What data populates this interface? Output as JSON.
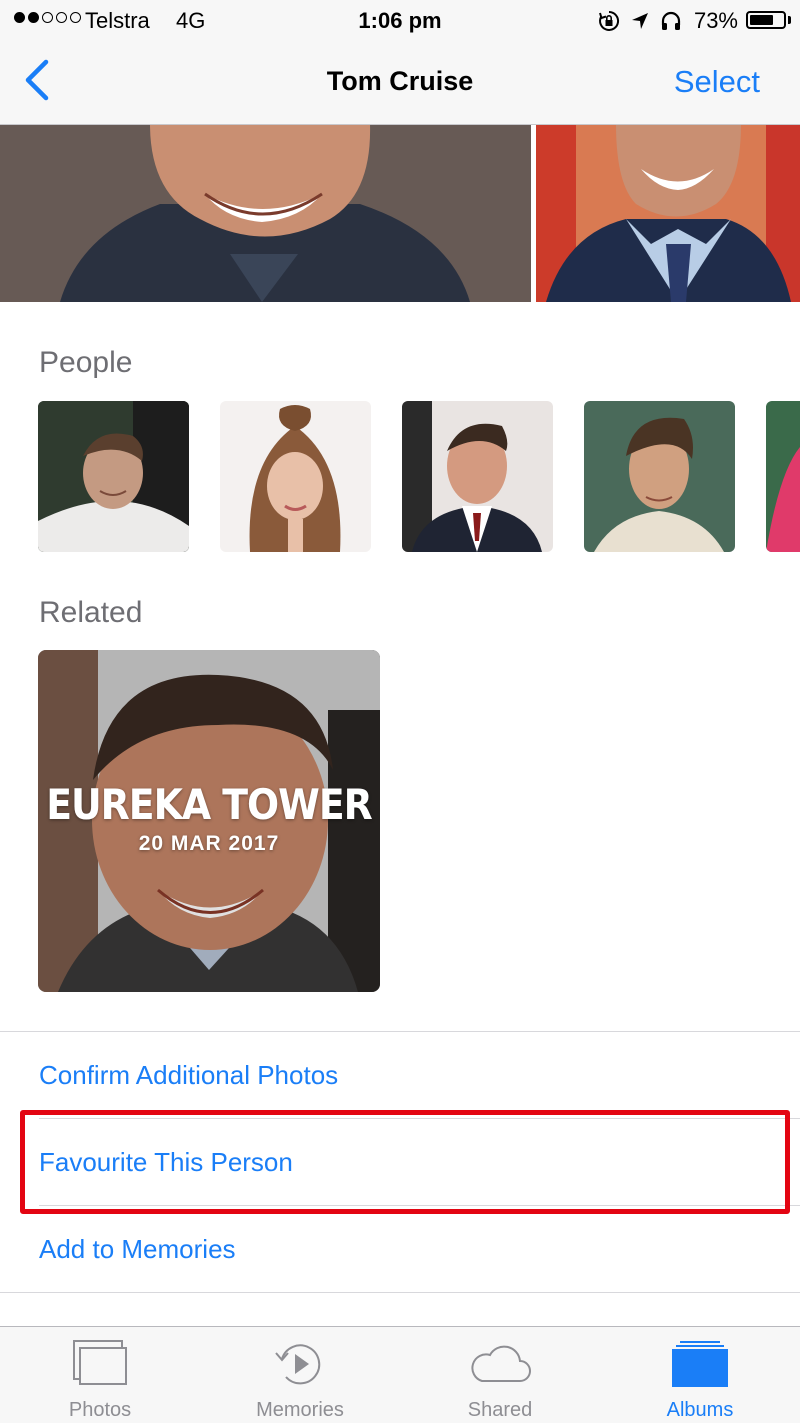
{
  "status_bar": {
    "signal_bars_filled": 2,
    "signal_bars_total": 5,
    "carrier": "Telstra",
    "network": "4G",
    "time": "1:06 pm",
    "battery_percent": "73%",
    "battery_level": 0.73,
    "icons": [
      "orientation-lock-icon",
      "location-arrow-icon",
      "headphones-icon"
    ]
  },
  "nav": {
    "back_icon": "chevron-left-icon",
    "title": "Tom Cruise",
    "select_label": "Select"
  },
  "people": {
    "heading": "People",
    "thumbnails": [
      "person-thumbnail-1",
      "person-thumbnail-2",
      "person-thumbnail-3",
      "person-thumbnail-4",
      "person-thumbnail-5"
    ]
  },
  "related": {
    "heading": "Related",
    "memory": {
      "title": "EUREKA TOWER",
      "date": "20 MAR 2017"
    }
  },
  "actions": {
    "confirm": "Confirm Additional Photos",
    "favourite": "Favourite This Person",
    "memories": "Add to Memories"
  },
  "tabs": [
    {
      "label": "Photos",
      "icon": "photos-stack-icon",
      "active": false
    },
    {
      "label": "Memories",
      "icon": "memories-play-icon",
      "active": false
    },
    {
      "label": "Shared",
      "icon": "cloud-icon",
      "active": false
    },
    {
      "label": "Albums",
      "icon": "albums-folder-icon",
      "active": true
    }
  ],
  "colors": {
    "accent": "#1a7ef7",
    "highlight": "#e30512",
    "section_heading": "#6e6e73",
    "inactive_tab": "#8e8e93"
  }
}
